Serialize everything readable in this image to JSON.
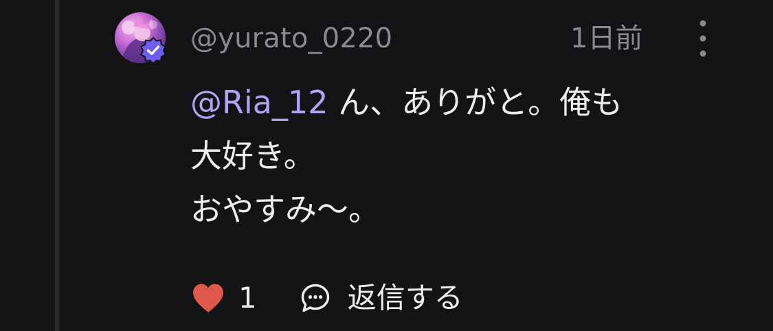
{
  "comment": {
    "username": "@yurato_0220",
    "timestamp": "1日前",
    "mention": "@Ria_12",
    "line1_rest": " ん、ありがと。俺も",
    "line2": "大好き。",
    "line3": "おやすみ〜。",
    "avatar_icon": "avatar-image",
    "verified_icon": "verified-badge-icon",
    "more_icon": "more-vertical-icon"
  },
  "actions": {
    "like_icon": "heart-icon",
    "like_count": "1",
    "reply_icon": "speech-bubble-icon",
    "reply_label": "返信する"
  },
  "colors": {
    "background": "#131315",
    "muted_text": "#8a8a8e",
    "text": "#ededef",
    "mention": "#b3a3f4",
    "heart": "#e0574b",
    "verified": "#6f5cf0"
  }
}
